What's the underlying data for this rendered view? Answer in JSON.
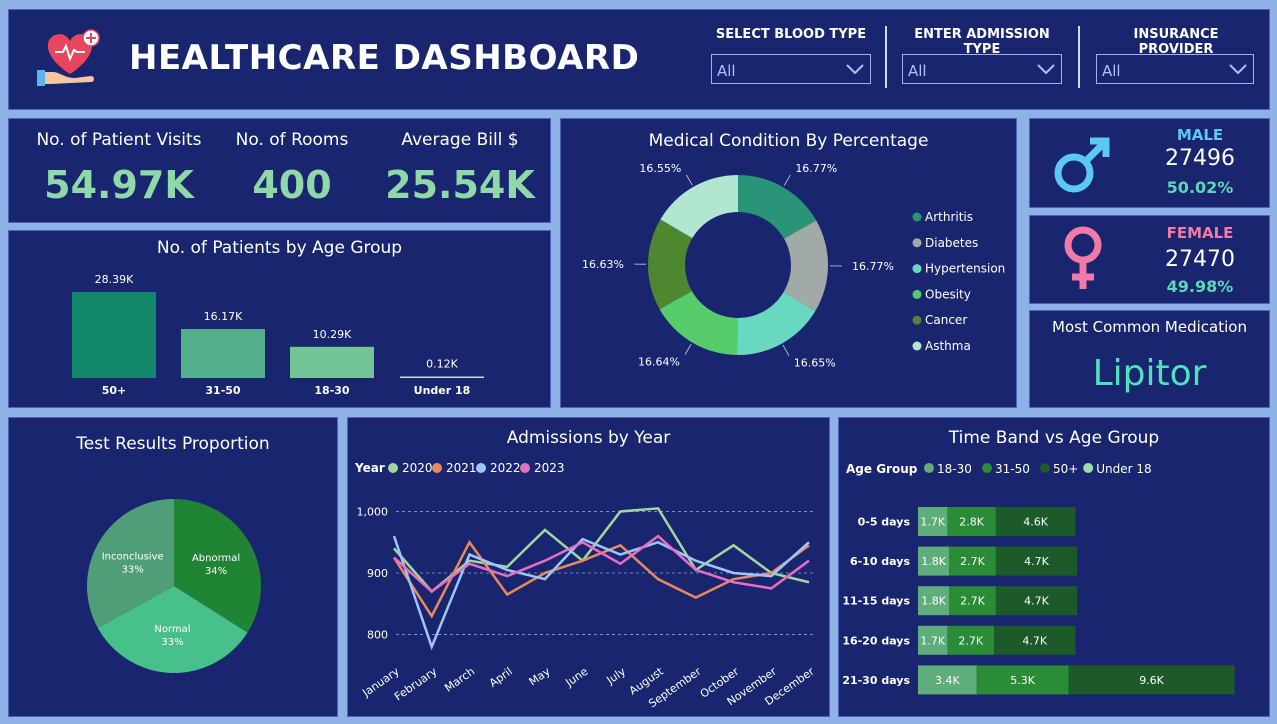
{
  "header": {
    "title": "HEALTHCARE DASHBOARD",
    "filters": [
      {
        "label": "SELECT BLOOD TYPE",
        "value": "All"
      },
      {
        "label": "ENTER ADMISSION TYPE",
        "value": "All"
      },
      {
        "label": "INSURANCE PROVIDER",
        "value": "All"
      }
    ]
  },
  "kpis": [
    {
      "label": "No. of Patient Visits",
      "value": "54.97K"
    },
    {
      "label": "No. of Rooms",
      "value": "400"
    },
    {
      "label": "Average Bill $",
      "value": "25.54K"
    }
  ],
  "gender": {
    "male": {
      "label": "MALE",
      "count": "27496",
      "pct": "50.02%",
      "color": "#5bc8f5"
    },
    "female": {
      "label": "FEMALE",
      "count": "27470",
      "pct": "49.98%",
      "color": "#f27aa8"
    }
  },
  "medication": {
    "title": "Most Common Medication",
    "value": "Lipitor"
  },
  "colors": {
    "panel": "#1a2570",
    "accent": "#8fd9a8"
  },
  "charts": {
    "age": {
      "title": "No. of Patients by Age Group",
      "chart_data": {
        "type": "bar",
        "categories": [
          "50+",
          "31-50",
          "18-30",
          "Under 18"
        ],
        "values": [
          28.39,
          16.17,
          10.29,
          0.12
        ],
        "labels": [
          "28.39K",
          "16.17K",
          "10.29K",
          "0.12K"
        ],
        "colors": [
          "#12876a",
          "#53ae8c",
          "#73c598",
          "#bde8c8"
        ]
      }
    },
    "condition": {
      "title": "Medical Condition By Percentage",
      "chart_data": {
        "type": "pie",
        "categories": [
          "Arthritis",
          "Diabetes",
          "Hypertension",
          "Obesity",
          "Cancer",
          "Asthma"
        ],
        "values": [
          16.77,
          16.77,
          16.65,
          16.64,
          16.63,
          16.55
        ],
        "labels": [
          "16.77%",
          "16.77%",
          "16.65%",
          "16.64%",
          "16.63%",
          "16.55%"
        ],
        "colors": [
          "#2a9478",
          "#a1aaa6",
          "#68d8c0",
          "#56cc6c",
          "#4d8730",
          "#b1e6d0"
        ]
      }
    },
    "tests": {
      "title": "Test Results Proportion",
      "chart_data": {
        "type": "pie",
        "categories": [
          "Abnormal",
          "Normal",
          "Inconclusive"
        ],
        "values": [
          34,
          33,
          33
        ],
        "labels": [
          "34%",
          "33%",
          "33%"
        ],
        "colors": [
          "#1f8434",
          "#48c08c",
          "#4f9e78"
        ]
      }
    },
    "admissions": {
      "title": "Admissions by Year",
      "legend_title": "Year",
      "chart_data": {
        "type": "line",
        "x": [
          "January",
          "February",
          "March",
          "April",
          "May",
          "June",
          "July",
          "August",
          "September",
          "October",
          "November",
          "December"
        ],
        "ylim": [
          770,
          1030
        ],
        "yticks": [
          800,
          900,
          1000
        ],
        "ytick_labels": [
          "800",
          "900",
          "1,000"
        ],
        "series": [
          {
            "name": "2020",
            "color": "#9ed99b",
            "values": [
              940,
              870,
              920,
              910,
              970,
              920,
              1000,
              1005,
              905,
              945,
              900,
              885
            ]
          },
          {
            "name": "2021",
            "color": "#ea8a5c",
            "values": [
              925,
              830,
              950,
              865,
              900,
              920,
              945,
              890,
              860,
              890,
              900,
              945
            ]
          },
          {
            "name": "2022",
            "color": "#9cc7f5",
            "values": [
              960,
              780,
              930,
              905,
              890,
              955,
              930,
              950,
              920,
              900,
              895,
              950
            ]
          },
          {
            "name": "2023",
            "color": "#e76fbf",
            "values": [
              925,
              870,
              915,
              895,
              920,
              950,
              915,
              960,
              905,
              885,
              875,
              920
            ]
          }
        ]
      }
    },
    "timeband": {
      "title": "Time Band vs Age Group",
      "legend_title": "Age Group",
      "chart_data": {
        "type": "bar",
        "orientation": "horizontal-stacked",
        "categories": [
          "0-5 days",
          "6-10 days",
          "11-15 days",
          "16-20 days",
          "21-30 days"
        ],
        "series": [
          {
            "name": "18-30",
            "color": "#5fad7b",
            "values": [
              1.7,
              1.8,
              1.8,
              1.7,
              3.4
            ],
            "labels": [
              "1.7K",
              "1.8K",
              "1.8K",
              "1.7K",
              "3.4K"
            ]
          },
          {
            "name": "31-50",
            "color": "#2a8c37",
            "values": [
              2.8,
              2.7,
              2.7,
              2.7,
              5.3
            ],
            "labels": [
              "2.8K",
              "2.7K",
              "2.7K",
              "2.7K",
              "5.3K"
            ]
          },
          {
            "name": "50+",
            "color": "#1c5a2a",
            "values": [
              4.6,
              4.7,
              4.7,
              4.7,
              9.6
            ],
            "labels": [
              "4.6K",
              "4.7K",
              "4.7K",
              "4.7K",
              "9.6K"
            ]
          },
          {
            "name": "Under 18",
            "color": "#9bdca8",
            "values": [
              0,
              0,
              0,
              0,
              0
            ],
            "labels": [
              "",
              "",
              "",
              "",
              ""
            ]
          }
        ]
      }
    }
  }
}
